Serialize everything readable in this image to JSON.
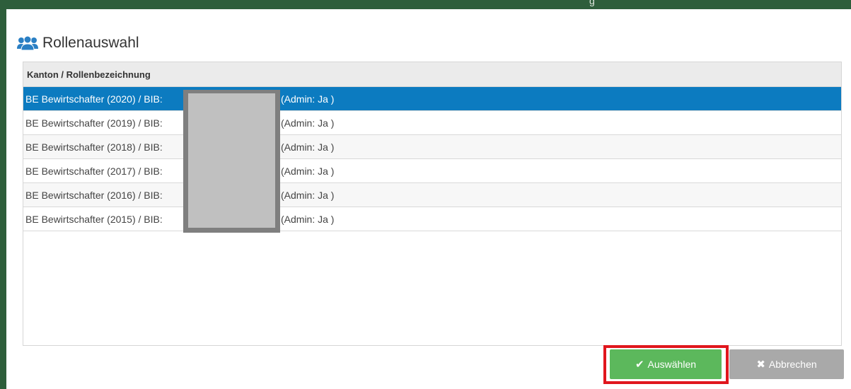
{
  "background": {
    "header_fragment": "g"
  },
  "dialog": {
    "title": "Rollenauswahl",
    "title_icon": "users-icon"
  },
  "grid": {
    "columns": [
      "Kanton / Rollenbezeichnung"
    ],
    "selected_index": 0,
    "rows": [
      {
        "role": "BE Bewirtschafter (2020) / BIB:",
        "admin": "(Admin: Ja )"
      },
      {
        "role": "BE Bewirtschafter (2019) / BIB:",
        "admin": "(Admin: Ja )"
      },
      {
        "role": "BE Bewirtschafter (2018) / BIB:",
        "admin": "(Admin: Ja )"
      },
      {
        "role": "BE Bewirtschafter (2017) / BIB:",
        "admin": "(Admin: Ja )"
      },
      {
        "role": "BE Bewirtschafter (2016) / BIB:",
        "admin": "(Admin: Ja )"
      },
      {
        "role": "BE Bewirtschafter (2015) / BIB:",
        "admin": "(Admin: Ja )"
      }
    ]
  },
  "buttons": {
    "select_label": "Auswählen",
    "select_icon": "check-icon",
    "cancel_label": "Abbrechen",
    "cancel_icon": "x-icon"
  },
  "colors": {
    "selected_row": "#0c7bc0",
    "select_button": "#5cb85c",
    "cancel_button": "#a9a9a9",
    "highlight": "#e0161d",
    "background_green": "#2e5e3b"
  }
}
